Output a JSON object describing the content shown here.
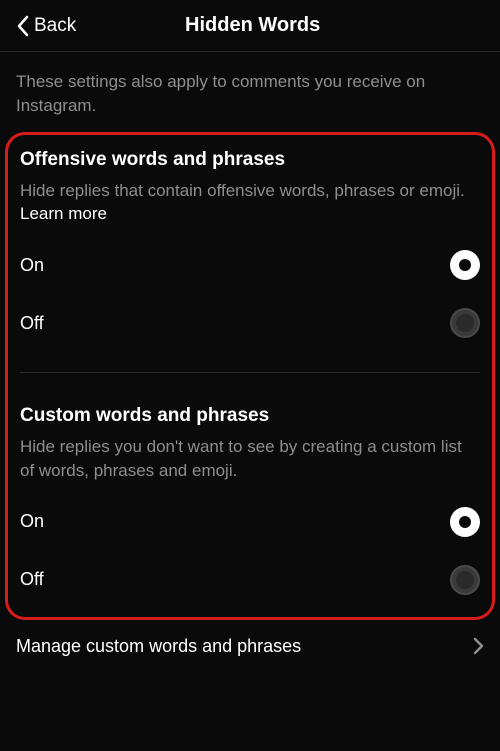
{
  "header": {
    "back_label": "Back",
    "title": "Hidden Words"
  },
  "intro": "These settings also apply to comments you receive on Instagram.",
  "sections": {
    "offensive": {
      "title": "Offensive words and phrases",
      "desc": "Hide replies that contain offensive words, phrases or emoji. ",
      "learn_more": "Learn more",
      "on_label": "On",
      "off_label": "Off",
      "selected": "on"
    },
    "custom": {
      "title": "Custom words and phrases",
      "desc": "Hide replies you don't want to see by creating a custom list of words, phrases and emoji.",
      "on_label": "On",
      "off_label": "Off",
      "selected": "on"
    }
  },
  "manage": {
    "label": "Manage custom words and phrases"
  }
}
